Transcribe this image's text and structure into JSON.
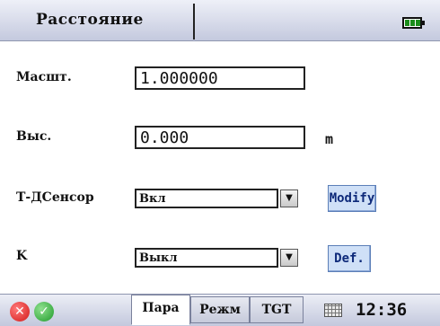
{
  "title": "Расстояние",
  "scale": {
    "label": "Масшт.",
    "value": "1.000000"
  },
  "height": {
    "label": "Выс.",
    "value": "0.000",
    "unit": "m"
  },
  "tsensor": {
    "label": "Т-ДСенсор",
    "value": "Вкл",
    "button": "Modify"
  },
  "k": {
    "label": "K",
    "value": "Выкл",
    "button": "Def."
  },
  "tabs": [
    "Пара",
    "Режм",
    "TGT"
  ],
  "clock": "12:36",
  "colors": {
    "battery": "#1a8c1a",
    "button": "#cfe0f7",
    "cancel": "#d21818",
    "ok": "#1f9b2a"
  },
  "icons": {
    "cancel": "close-icon",
    "ok": "check-icon",
    "battery": "battery-icon",
    "keyboard": "keyboard-icon"
  }
}
